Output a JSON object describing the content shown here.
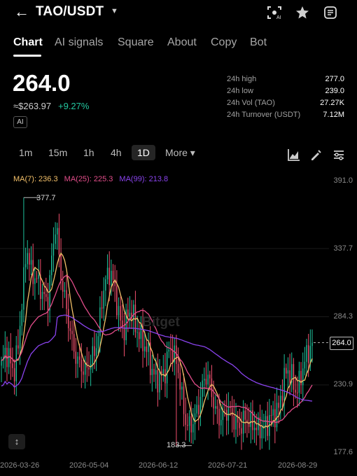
{
  "header": {
    "back_icon": "arrow-left-icon",
    "pair": "TAO/USDT",
    "caret": "▼"
  },
  "top_icons": [
    "ai-eye-icon",
    "star-icon",
    "share-icon"
  ],
  "tabs": [
    "Chart",
    "AI signals",
    "Square",
    "About",
    "Copy",
    "Bot"
  ],
  "active_tab": "Chart",
  "ticker": {
    "last": "264.0",
    "fiat": "≈$263.97",
    "change": "+9.27%",
    "ai_label": "AI"
  },
  "stats": [
    {
      "label": "24h high",
      "value": "277.0"
    },
    {
      "label": "24h low",
      "value": "239.0"
    },
    {
      "label": "24h Vol (TAO)",
      "value": "27.27K"
    },
    {
      "label": "24h Turnover (USDT)",
      "value": "7.12M"
    }
  ],
  "intervals": [
    "1m",
    "15m",
    "1h",
    "4h",
    "1D",
    "More ▾"
  ],
  "active_interval": "1D",
  "ma": {
    "ma7": "MA(7): 236.3",
    "ma25": "MA(25): 225.3",
    "ma99": "MA(99): 213.8"
  },
  "watermark": "Bitget",
  "colors": {
    "up": "#1fbf9a",
    "down": "#f0506e",
    "ma7": "#f3c069",
    "ma25": "#e24d8a",
    "ma99": "#8a43ee"
  },
  "chart_data": {
    "type": "candlestick",
    "interval": "1D",
    "yticks": [
      "391.0",
      "337.7",
      "284.3",
      "230.9",
      "177.6"
    ],
    "ylim": [
      177.6,
      391.0
    ],
    "xticks": [
      "2026-03-26",
      "2026-05-04",
      "2026-06-12",
      "2026-07-21",
      "2026-08-29"
    ],
    "high_marker": {
      "label": "377.7",
      "value": 377.7
    },
    "low_marker": {
      "label": "183.3",
      "value": 183.3
    },
    "last_price": {
      "label": "264.0",
      "value": 264.0
    },
    "close_path": [
      245,
      258,
      250,
      240,
      262,
      300,
      340,
      320,
      315,
      310,
      300,
      295,
      330,
      360,
      320,
      300,
      280,
      262,
      250,
      245,
      242,
      248,
      255,
      268,
      300,
      315,
      320,
      305,
      285,
      272,
      285,
      290,
      275,
      270,
      262,
      255,
      240,
      235,
      238,
      242,
      260,
      255,
      245,
      220,
      200,
      198,
      205,
      215,
      232,
      240,
      225,
      210,
      204,
      208,
      212,
      206,
      200,
      198,
      205,
      202,
      200,
      196,
      198,
      199,
      205,
      208,
      212,
      230,
      244,
      238,
      226,
      232,
      248,
      256,
      264
    ]
  }
}
